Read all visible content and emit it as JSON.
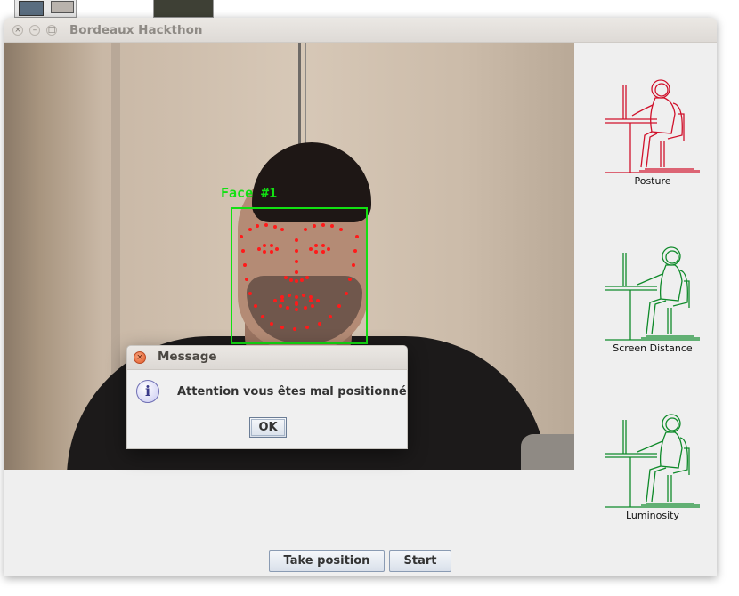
{
  "window": {
    "title": "Bordeaux Hackthon"
  },
  "camera": {
    "face_label": "Face #1"
  },
  "indicators": [
    {
      "label": "Posture",
      "color": "#d0112b",
      "icon": "posture-icon"
    },
    {
      "label": "Screen Distance",
      "color": "#0f8a2a",
      "icon": "screen-distance-icon"
    },
    {
      "label": "Luminosity",
      "color": "#0f8a2a",
      "icon": "luminosity-icon"
    }
  ],
  "buttons": {
    "take_position": "Take position",
    "start": "Start"
  },
  "dialog": {
    "title": "Message",
    "message": "Attention vous êtes mal positionné",
    "ok": "OK",
    "icon": "info-icon"
  }
}
